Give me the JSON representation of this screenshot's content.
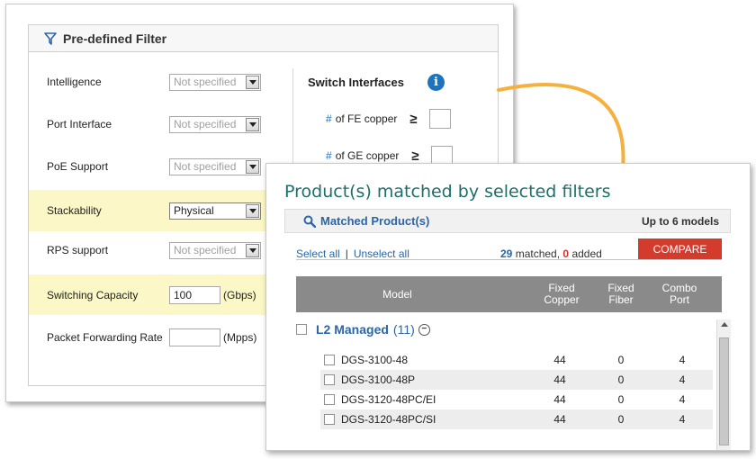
{
  "filter": {
    "title": "Pre-defined Filter",
    "rows": [
      {
        "label": "Intelligence",
        "value": "Not specified"
      },
      {
        "label": "Port Interface",
        "value": "Not specified"
      },
      {
        "label": "PoE Support",
        "value": "Not specified"
      },
      {
        "label": "Stackability",
        "value": "Physical"
      },
      {
        "label": "RPS support",
        "value": "Not specified"
      },
      {
        "label": "Switching Capacity",
        "value": "100",
        "unit": "(Gbps)"
      },
      {
        "label": "Packet Forwarding Rate",
        "value": "",
        "unit": "(Mpps)"
      }
    ],
    "switch": {
      "title": "Switch Interfaces",
      "rows": [
        {
          "hash": "#",
          "label": "of FE copper",
          "op": "≥"
        },
        {
          "hash": "#",
          "label": "of GE copper",
          "op": "≥"
        }
      ]
    }
  },
  "matched": {
    "title": "Product(s) matched by selected filters",
    "header": "Matched Product(s)",
    "upto": "Up to 6 models",
    "select_all": "Select all",
    "separator": "|",
    "unselect_all": "Unselect all",
    "matched_count": "29",
    "matched_text": "matched,",
    "added_count": "0",
    "added_text": "added",
    "compare": "COMPARE",
    "columns": [
      "Model",
      "Fixed Copper",
      "Fixed Fiber",
      "Combo Port"
    ],
    "group": {
      "name": "L2 Managed",
      "count": "(11)"
    },
    "products": [
      {
        "name": "DGS-3100-48",
        "copper": "44",
        "fiber": "0",
        "combo": "4"
      },
      {
        "name": "DGS-3100-48P",
        "copper": "44",
        "fiber": "0",
        "combo": "4"
      },
      {
        "name": "DGS-3120-48PC/EI",
        "copper": "44",
        "fiber": "0",
        "combo": "4"
      },
      {
        "name": "DGS-3120-48PC/SI",
        "copper": "44",
        "fiber": "0",
        "combo": "4"
      }
    ]
  },
  "colors": {
    "accent_blue": "#2b66a8",
    "compare_red": "#d33b2c",
    "highlight_yellow": "#fbf7c6",
    "arrow_orange": "#f5b13d",
    "title_teal": "#1e6f6a"
  }
}
